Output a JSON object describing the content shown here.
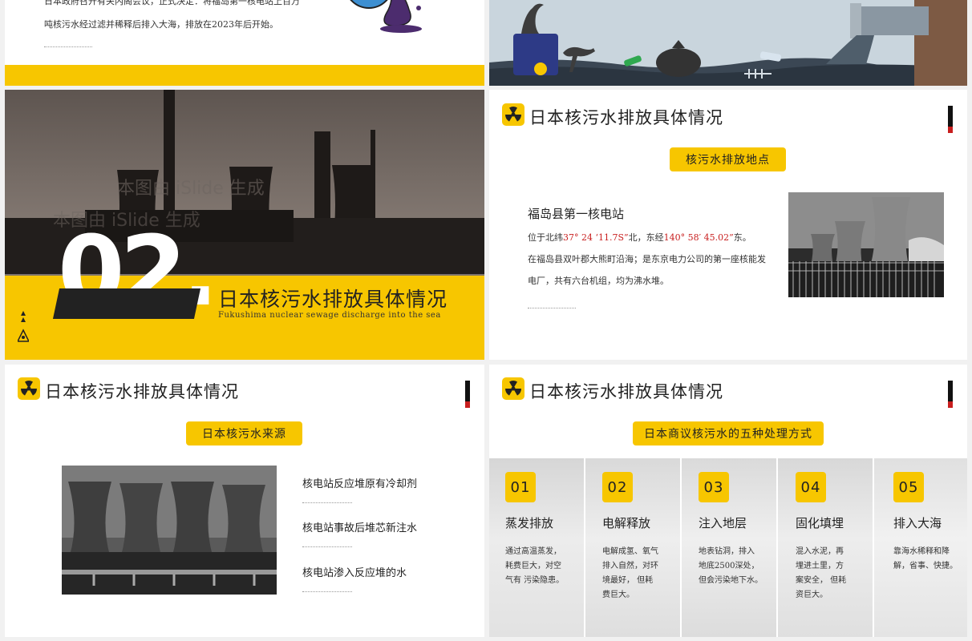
{
  "colors": {
    "accent": "#f7c600",
    "dark": "#222222",
    "red": "#c81e1e"
  },
  "slide_a": {
    "line1": "日本政府召开有关内阁会议，正式决定：将福岛第一核电站上百万",
    "line2": "吨核污水经过滤并稀释后排入大海，排放在2023年后开始。"
  },
  "slide_c": {
    "number": "02.",
    "title": "日本核污水排放具体情况",
    "subtitle": "Fukushima nuclear sewage discharge into the sea",
    "watermark": "本图由 iSlide 生成"
  },
  "section_title": "日本核污水排放具体情况",
  "slide_d": {
    "pill": "核污水排放地点",
    "heading": "福岛县第一核电站",
    "coord": {
      "pre": "位于北纬",
      "lat": "37° 24 ‘11.7S”",
      "mid": "北，东经",
      "lon": "140° 58′ 45.02”",
      "post": "东。"
    },
    "desc1": "在福岛县双叶郡大熊町沿海；是东京电力公司的第一座核能发",
    "desc2": "电厂，共有六台机组，均为沸水堆。"
  },
  "slide_e": {
    "pill": "日本核污水来源",
    "items": [
      "核电站反应堆原有冷却剂",
      "核电站事故后堆芯新注水",
      "核电站渗入反应堆的水"
    ]
  },
  "slide_f": {
    "pill": "日本商议核污水的五种处理方式",
    "cards": [
      {
        "num": "01",
        "title": "蒸发排放",
        "lines": [
          "通过高温蒸发，",
          "耗费巨大，对空",
          "气有  污染隐患。"
        ]
      },
      {
        "num": "02",
        "title": "电解释放",
        "lines": [
          "电解成氢、氧气",
          "排入自然，对环",
          "境最好，  但耗",
          "费巨大。"
        ]
      },
      {
        "num": "03",
        "title": "注入地层",
        "lines": [
          "地表钻洞，排入",
          "地底2500深处，",
          "但会污染地下水。"
        ]
      },
      {
        "num": "04",
        "title": "固化填埋",
        "lines": [
          "混入水泥，再",
          "埋进土里，方",
          "案安全，  但耗",
          "资巨大。"
        ]
      },
      {
        "num": "05",
        "title": "排入大海",
        "lines": [
          "靠海水稀释和降",
          "解，省事、快捷。"
        ]
      }
    ]
  }
}
